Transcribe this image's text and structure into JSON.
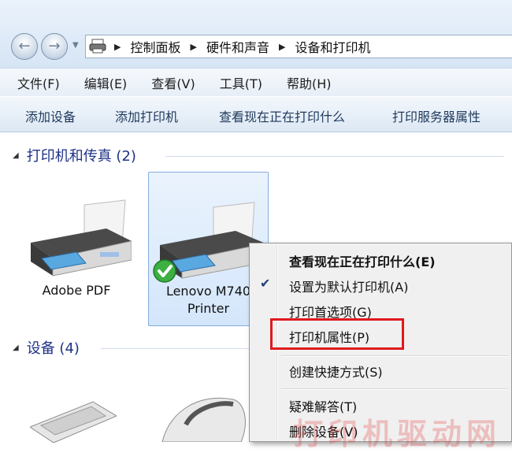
{
  "breadcrumb": [
    "控制面板",
    "硬件和声音",
    "设备和打印机"
  ],
  "menubar": {
    "items": [
      "文件(F)",
      "编辑(E)",
      "查看(V)",
      "工具(T)",
      "帮助(H)"
    ]
  },
  "toolbar": {
    "buttons": [
      "添加设备",
      "添加打印机",
      "查看现在正在打印什么",
      "打印服务器属性"
    ]
  },
  "groups": {
    "printers": {
      "title": "打印机和传真 (2)"
    },
    "devices": {
      "title": "设备 (4)"
    }
  },
  "printers": [
    {
      "name": "Adobe PDF"
    },
    {
      "name_line1": "Lenovo M740",
      "name_line2": "Printer",
      "default": true
    }
  ],
  "context_menu": {
    "items": [
      {
        "label": "查看现在正在打印什么(E)",
        "bold": true
      },
      {
        "label": "设置为默认打印机(A)",
        "checked": true
      },
      {
        "label": "打印首选项(G)"
      },
      {
        "label": "打印机属性(P)",
        "highlighted": true
      },
      {
        "label": "创建快捷方式(S)"
      },
      {
        "label": "疑难解答(T)"
      },
      {
        "label": "删除设备(V)"
      }
    ]
  },
  "watermark": "打印机驱动网",
  "colors": {
    "highlight_box": "#e0191c",
    "group_header": "#1e3287",
    "selection_bg": "#d4e6fb"
  }
}
